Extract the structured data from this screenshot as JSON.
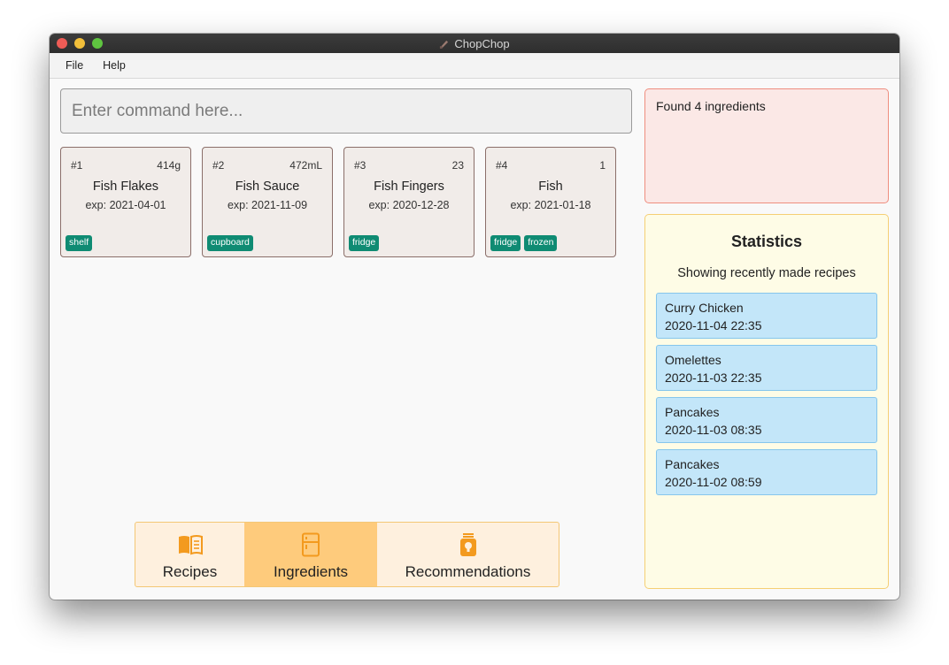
{
  "window": {
    "title": "ChopChop"
  },
  "menu": {
    "items": [
      "File",
      "Help"
    ]
  },
  "command": {
    "placeholder": "Enter command here...",
    "value": ""
  },
  "ingredients": [
    {
      "index": "#1",
      "quantity": "414g",
      "name": "Fish Flakes",
      "expiry": "exp: 2021-04-01",
      "tags": [
        "shelf"
      ]
    },
    {
      "index": "#2",
      "quantity": "472mL",
      "name": "Fish Sauce",
      "expiry": "exp: 2021-11-09",
      "tags": [
        "cupboard"
      ]
    },
    {
      "index": "#3",
      "quantity": "23",
      "name": "Fish Fingers",
      "expiry": "exp: 2020-12-28",
      "tags": [
        "fridge"
      ]
    },
    {
      "index": "#4",
      "quantity": "1",
      "name": "Fish",
      "expiry": "exp: 2021-01-18",
      "tags": [
        "fridge",
        "frozen"
      ]
    }
  ],
  "result": {
    "message": "Found 4 ingredients"
  },
  "statistics": {
    "title": "Statistics",
    "subtitle": "Showing recently made recipes",
    "items": [
      {
        "name": "Curry Chicken",
        "time": "2020-11-04 22:35"
      },
      {
        "name": "Omelettes",
        "time": "2020-11-03 22:35"
      },
      {
        "name": "Pancakes",
        "time": "2020-11-03 08:35"
      },
      {
        "name": "Pancakes",
        "time": "2020-11-02 08:59"
      }
    ]
  },
  "tabs": [
    {
      "label": "Recipes",
      "icon": "recipe-book-icon",
      "active": false
    },
    {
      "label": "Ingredients",
      "icon": "fridge-icon",
      "active": true
    },
    {
      "label": "Recommendations",
      "icon": "lightbulb-jar-icon",
      "active": false
    }
  ],
  "colors": {
    "accent": "#f39a1e",
    "tag": "#0f8b73",
    "active_tab": "#fecb7c",
    "stat_item": "#c3e6f9"
  }
}
